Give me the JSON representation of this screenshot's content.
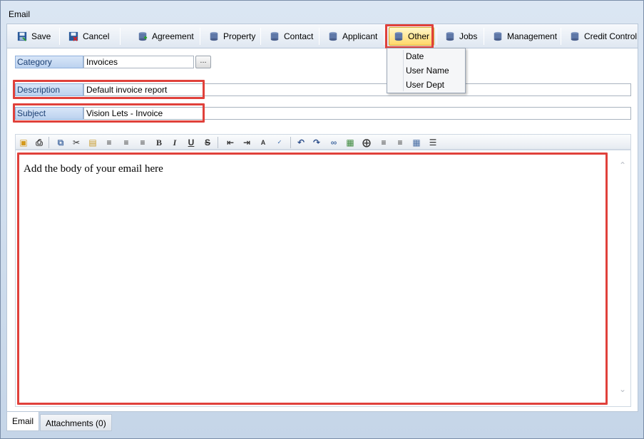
{
  "window": {
    "title": "Email"
  },
  "toolbar": {
    "save": "Save",
    "cancel": "Cancel",
    "agreement": "Agreement",
    "property": "Property",
    "contact": "Contact",
    "applicant": "Applicant",
    "other": "Other",
    "jobs": "Jobs",
    "management": "Management",
    "credit_control": "Credit Control"
  },
  "other_menu": {
    "items": [
      "Date",
      "User Name",
      "User Dept"
    ]
  },
  "form": {
    "category_label": "Category",
    "category_value": "Invoices",
    "browse_button": "...",
    "description_label": "Description",
    "description_value": "Default invoice report",
    "subject_label": "Subject",
    "subject_value": "Vision Lets - Invoice"
  },
  "editor": {
    "body_text": "Add the body of your email here"
  },
  "tabs": {
    "email": "Email",
    "attachments": "Attachments (0)"
  },
  "colors": {
    "highlight": "#e0413b",
    "label_bg": "#bcd2ef",
    "active_button": "#ffd86a"
  }
}
